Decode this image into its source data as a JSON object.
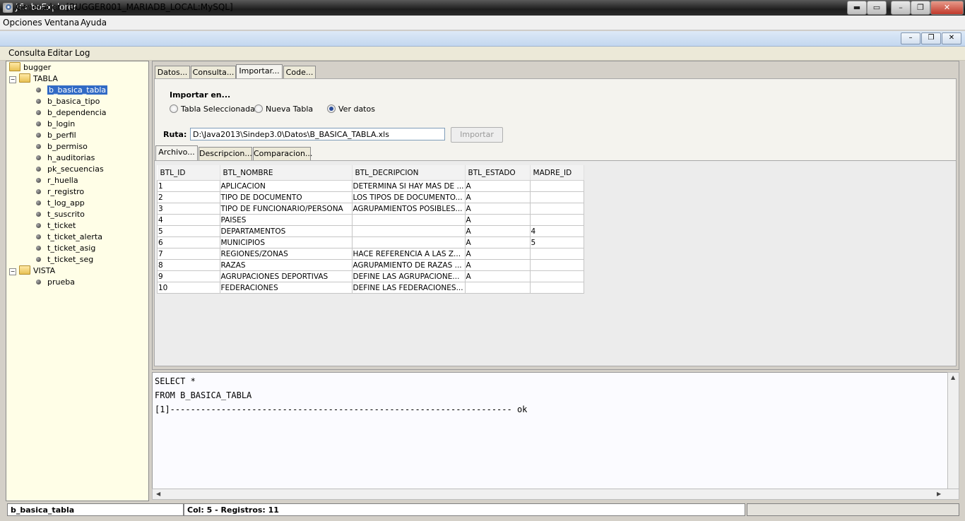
{
  "app": {
    "title": "JTurboExplorer",
    "menu": [
      "Opciones",
      "Ventana",
      "Ayuda"
    ]
  },
  "window": {
    "title": "Generador: [BUGGER001_MARIADB_LOCAL:MySQL]",
    "menu": [
      "Consulta",
      "Editar",
      "Log"
    ]
  },
  "tree": {
    "root": "bugger",
    "tabla_folder": "TABLA",
    "tables": [
      "b_basica_tabla",
      "b_basica_tipo",
      "b_dependencia",
      "b_login",
      "b_perfil",
      "b_permiso",
      "h_auditorias",
      "pk_secuencias",
      "r_huella",
      "r_registro",
      "t_log_app",
      "t_suscrito",
      "t_ticket",
      "t_ticket_alerta",
      "t_ticket_asig",
      "t_ticket_seg"
    ],
    "selected": "b_basica_tabla",
    "vista_folder": "VISTA",
    "views": [
      "prueba"
    ]
  },
  "tabs": [
    "Datos...",
    "Consulta...",
    "Importar...",
    "Code..."
  ],
  "active_tab": "Importar...",
  "import": {
    "group_label": "Importar en...",
    "options": [
      "Tabla Seleccionada",
      "Nueva Tabla",
      "Ver datos"
    ],
    "selected_option": "Ver datos",
    "ruta_label": "Ruta:",
    "ruta_value": "D:\\Java2013\\Sindep3.0\\Datos\\B_BASICA_TABLA.xls",
    "import_button": "Importar"
  },
  "subtabs": [
    "Archivo...",
    "Descripcion...",
    "Comparacion..."
  ],
  "active_subtab": "Archivo...",
  "grid": {
    "columns": [
      "BTL_ID",
      "BTL_NOMBRE",
      "BTL_DECRIPCION",
      "BTL_ESTADO",
      "MADRE_ID"
    ],
    "rows": [
      [
        "1",
        "APLICACION",
        "DETERMINA SI HAY MAS DE ...",
        "A",
        ""
      ],
      [
        "2",
        "TIPO DE DOCUMENTO",
        "LOS TIPOS DE DOCUMENTO...",
        "A",
        ""
      ],
      [
        "3",
        "TIPO DE FUNCIONARIO/PERSONA",
        "AGRUPAMIENTOS POSIBLES...",
        "A",
        ""
      ],
      [
        "4",
        "PAISES",
        "",
        "A",
        ""
      ],
      [
        "5",
        "DEPARTAMENTOS",
        "",
        "A",
        "4"
      ],
      [
        "6",
        "MUNICIPIOS",
        "",
        "A",
        "5"
      ],
      [
        "7",
        "REGIONES/ZONAS",
        "HACE REFERENCIA A LAS Z...",
        "A",
        ""
      ],
      [
        "8",
        "RAZAS",
        "AGRUPAMIENTO DE RAZAS ...",
        "A",
        ""
      ],
      [
        "9",
        "AGRUPACIONES DEPORTIVAS",
        "DEFINE LAS AGRUPACIONE...",
        "A",
        ""
      ],
      [
        "10",
        "FEDERACIONES",
        "DEFINE LAS FEDERACIONES...",
        "",
        ""
      ]
    ]
  },
  "console": {
    "lines": [
      "SELECT *",
      "FROM B_BASICA_TABLA",
      "[1]------------------------------------------------------------------- ok"
    ]
  },
  "status": {
    "table": "b_basica_tabla",
    "info": "Col: 5 - Registros: 11"
  }
}
